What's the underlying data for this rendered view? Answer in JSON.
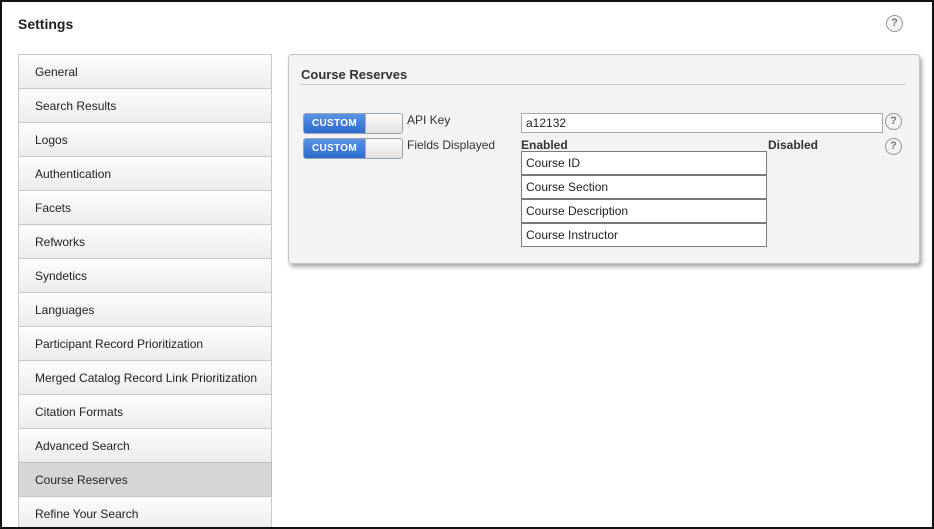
{
  "header": {
    "title": "Settings"
  },
  "sidebar": {
    "items": [
      {
        "label": "General"
      },
      {
        "label": "Search Results"
      },
      {
        "label": "Logos"
      },
      {
        "label": "Authentication"
      },
      {
        "label": "Facets"
      },
      {
        "label": "Refworks"
      },
      {
        "label": "Syndetics"
      },
      {
        "label": "Languages"
      },
      {
        "label": "Participant Record Prioritization"
      },
      {
        "label": "Merged Catalog Record Link Prioritization"
      },
      {
        "label": "Citation Formats"
      },
      {
        "label": "Advanced Search"
      },
      {
        "label": "Course Reserves",
        "active": true
      },
      {
        "label": "Refine Your Search"
      }
    ]
  },
  "panel": {
    "title": "Course Reserves",
    "api_key": {
      "toggle_label": "CUSTOM",
      "label": "API Key",
      "value": "a12132"
    },
    "fields_displayed": {
      "toggle_label": "CUSTOM",
      "label": "Fields Displayed",
      "enabled_heading": "Enabled",
      "disabled_heading": "Disabled",
      "enabled_items": [
        "Course ID",
        "Course Section",
        "Course Description",
        "Course Instructor"
      ]
    }
  },
  "icons": {
    "help": "?"
  },
  "colors": {
    "toggle_on": "#2b6acb",
    "active_item": "#d6d6d6"
  }
}
